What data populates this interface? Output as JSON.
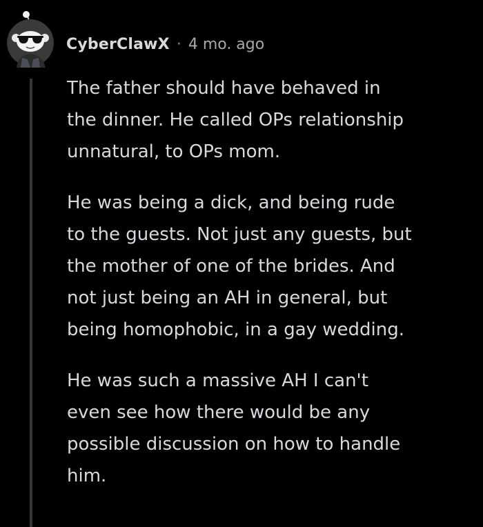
{
  "comment": {
    "author": "CyberClawX",
    "separator": "·",
    "timestamp": "4 mo. ago",
    "paragraphs": [
      {
        "lines": [
          "The father should have behaved in",
          "the dinner. He called OPs relationship",
          "unnatural, to OPs mom."
        ]
      },
      {
        "lines": [
          "He was being a dick, and being rude",
          "to the guests. Not just any guests, but",
          "the mother of one of the brides. And",
          "not just being an AH in general, but",
          "being homophobic, in a gay wedding."
        ]
      },
      {
        "lines": [
          "He was such a massive AH I can't",
          "even see how there would be any",
          "possible discussion on how to handle",
          "him."
        ]
      }
    ]
  },
  "icons": {
    "avatar": "snoo-sunglasses-avatar-icon"
  },
  "colors": {
    "background": "#000000",
    "text": "#d7dadc",
    "meta": "#a6a8aa",
    "thread_line": "#343536"
  }
}
